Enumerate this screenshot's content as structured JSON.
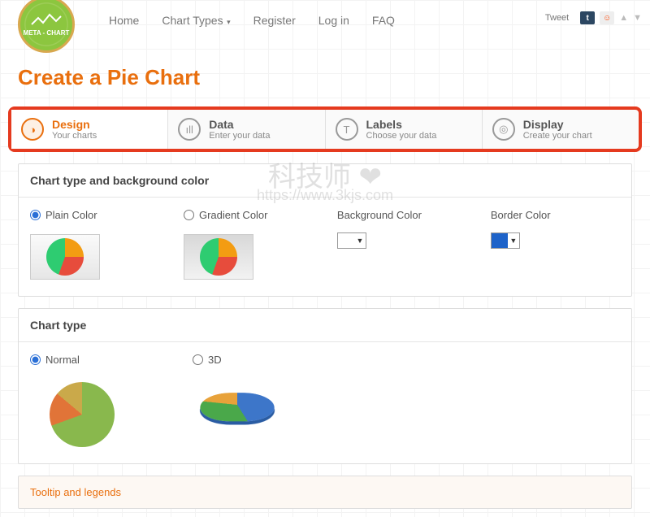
{
  "nav": {
    "home": "Home",
    "chart_types": "Chart Types",
    "register": "Register",
    "login": "Log in",
    "faq": "FAQ"
  },
  "logo_text": "META - CHART",
  "socials": {
    "tweet": "Tweet"
  },
  "page_title": "Create a Pie Chart",
  "steps": [
    {
      "title": "Design",
      "sub": "Your charts",
      "icon": "design-icon"
    },
    {
      "title": "Data",
      "sub": "Enter your data",
      "icon": "data-icon"
    },
    {
      "title": "Labels",
      "sub": "Choose your data",
      "icon": "labels-icon"
    },
    {
      "title": "Display",
      "sub": "Create your chart",
      "icon": "display-icon"
    }
  ],
  "panels": {
    "bg": {
      "heading": "Chart type and background color",
      "plain": "Plain Color",
      "gradient": "Gradient Color",
      "bgcolor": "Background Color",
      "bordercolor": "Border Color"
    },
    "type": {
      "heading": "Chart type",
      "normal": "Normal",
      "threeD": "3D"
    }
  },
  "accordion": {
    "tooltip": "Tooltip and legends"
  },
  "colors": {
    "bg_swatch": "#ffffff",
    "border_swatch": "#1e63c9"
  },
  "watermark": {
    "line1": "科技师 ❤",
    "line2": "https://www.3kjs.com"
  }
}
